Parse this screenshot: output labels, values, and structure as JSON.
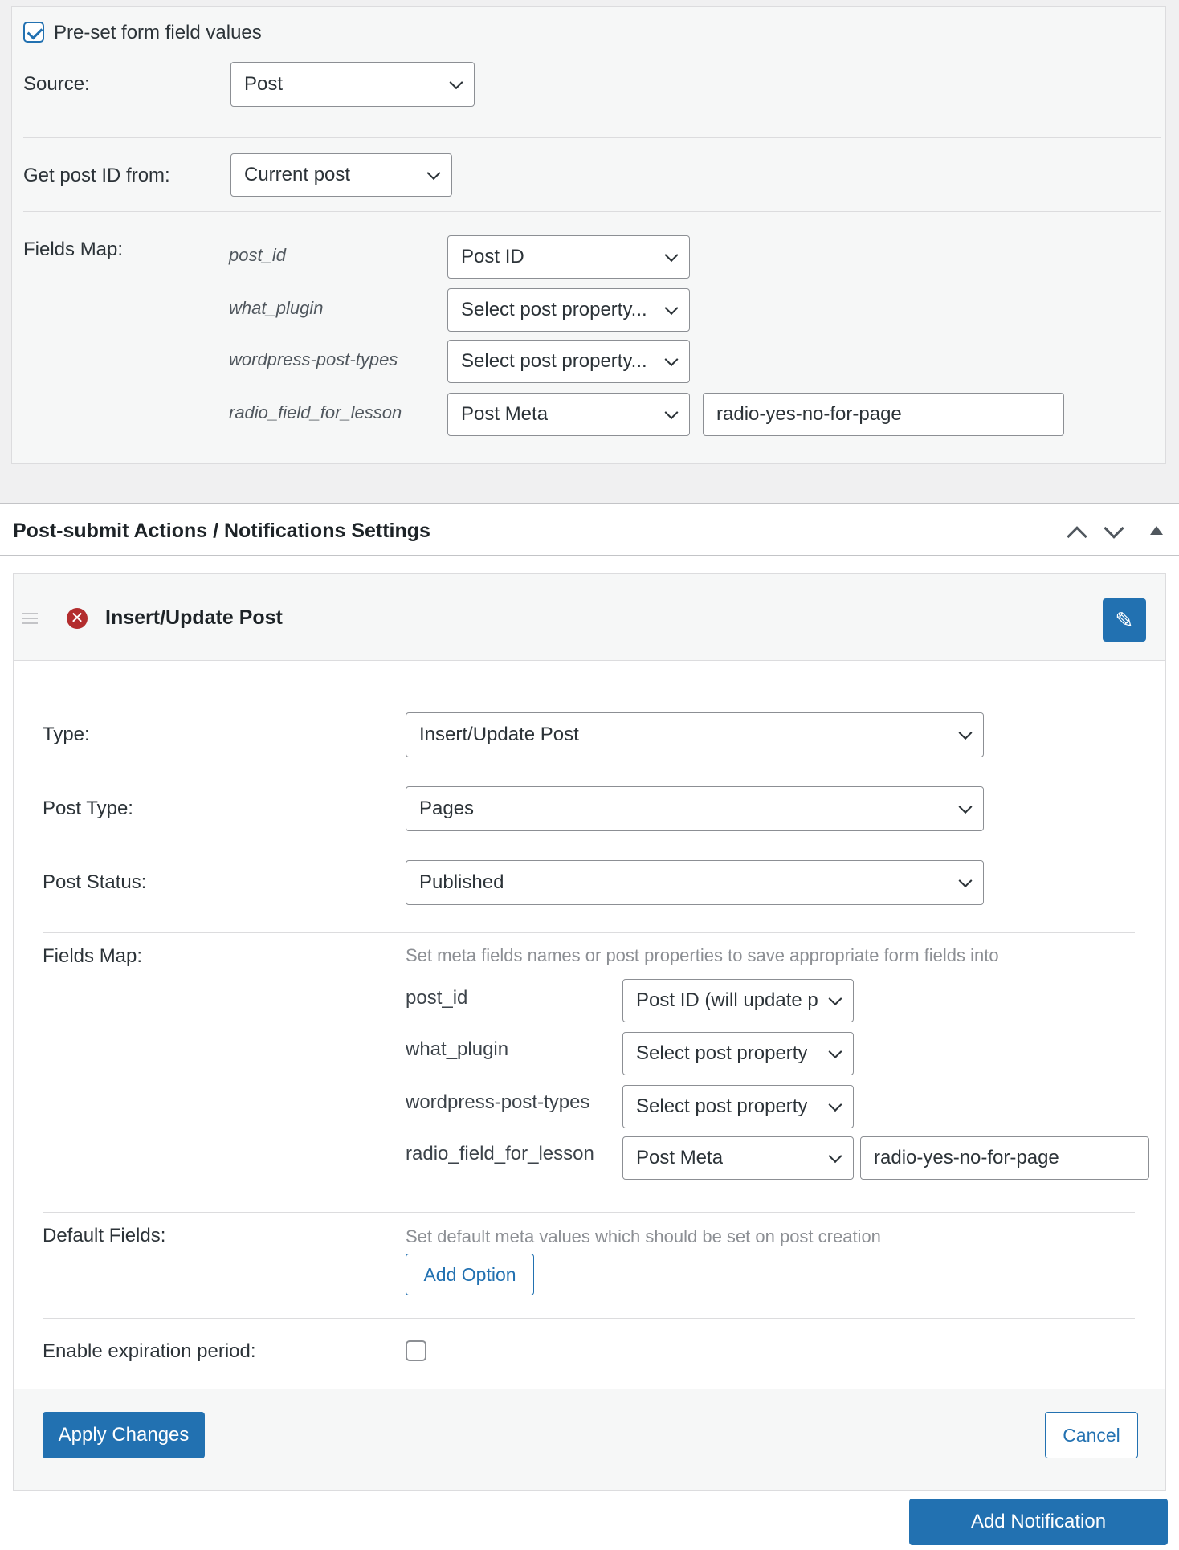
{
  "preset": {
    "checkbox_label": "Pre-set form field values",
    "checked": true,
    "source_label": "Source:",
    "source_value": "Post",
    "post_id_label": "Get post ID from:",
    "post_id_value": "Current post",
    "fields_map_label": "Fields Map:",
    "fields": [
      {
        "name": "post_id",
        "value": "Post ID"
      },
      {
        "name": "what_plugin",
        "value": "Select post property..."
      },
      {
        "name": "wordpress-post-types",
        "value": "Select post property..."
      },
      {
        "name": "radio_field_for_lesson",
        "value": "Post Meta",
        "meta_key": "radio-yes-no-for-page"
      }
    ]
  },
  "section": {
    "title": "Post-submit Actions / Notifications Settings"
  },
  "notification": {
    "title": "Insert/Update Post",
    "type_label": "Type:",
    "type_value": "Insert/Update Post",
    "post_type_label": "Post Type:",
    "post_type_value": "Pages",
    "post_status_label": "Post Status:",
    "post_status_value": "Published",
    "fields_map_label": "Fields Map:",
    "fields_map_help": "Set meta fields names or post properties to save appropriate form fields into",
    "fields": [
      {
        "name": "post_id",
        "value": "Post ID (will update p"
      },
      {
        "name": "what_plugin",
        "value": "Select post property"
      },
      {
        "name": "wordpress-post-types",
        "value": "Select post property"
      },
      {
        "name": "radio_field_for_lesson",
        "value": "Post Meta",
        "meta_key": "radio-yes-no-for-page"
      }
    ],
    "default_fields_label": "Default Fields:",
    "default_fields_help": "Set default meta values which should be set on post creation",
    "add_option_label": "Add Option",
    "expiration_label": "Enable expiration period:",
    "expiration_checked": false,
    "apply_label": "Apply Changes",
    "cancel_label": "Cancel"
  },
  "add_notification_label": "Add Notification",
  "colors": {
    "accent": "#2271b1",
    "error": "#b32d2e",
    "panel_bg": "#f6f7f7"
  }
}
